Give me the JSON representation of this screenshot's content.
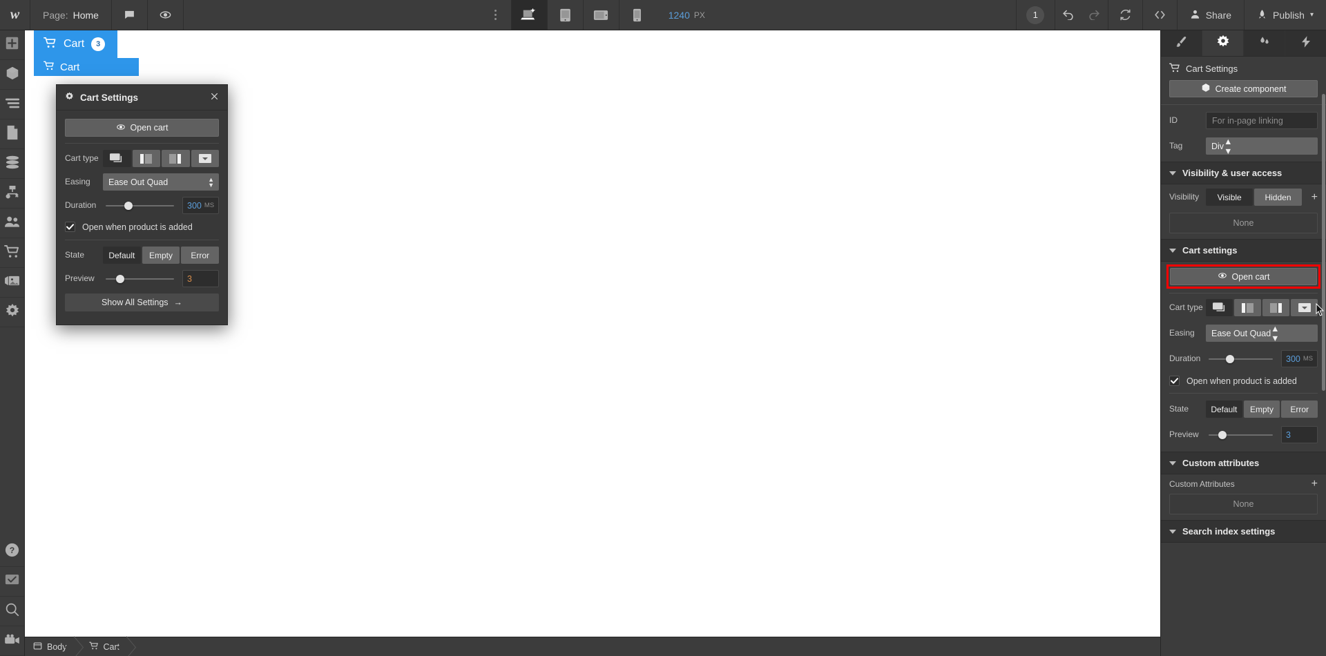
{
  "topbar": {
    "logo": "w",
    "page_label": "Page:",
    "page_value": "Home",
    "comment_icon": "comment-icon",
    "preview_icon": "eye-icon",
    "more_icon": "more-vertical-icon",
    "breakpoints": [
      {
        "name": "desktop-large",
        "icon": "desktop-star-icon",
        "active": true
      },
      {
        "name": "tablet",
        "icon": "tablet-icon",
        "active": false
      },
      {
        "name": "tablet-landscape",
        "icon": "tablet-landscape-icon",
        "active": false
      },
      {
        "name": "mobile",
        "icon": "mobile-icon",
        "active": false
      }
    ],
    "viewport_width": "1240",
    "viewport_unit": "PX",
    "change_count": "1",
    "undo_icon": "undo-icon",
    "redo_icon": "redo-icon",
    "sync_icon": "refresh-icon",
    "code_icon": "code-brackets-icon",
    "share_label": "Share",
    "publish_label": "Publish"
  },
  "rail": {
    "items": [
      {
        "name": "add-elements",
        "icon": "plus-icon"
      },
      {
        "name": "components",
        "icon": "cube-icon"
      },
      {
        "name": "navigator",
        "icon": "layers-list-icon"
      },
      {
        "name": "pages",
        "icon": "page-icon"
      },
      {
        "name": "cms",
        "icon": "database-icon"
      },
      {
        "name": "logic",
        "icon": "flow-icon"
      },
      {
        "name": "users",
        "icon": "users-icon"
      },
      {
        "name": "ecommerce",
        "icon": "cart-icon"
      },
      {
        "name": "assets",
        "icon": "image-stack-icon"
      },
      {
        "name": "settings",
        "icon": "gear-icon"
      }
    ],
    "bottom": [
      {
        "name": "help",
        "icon": "question-circle-icon"
      },
      {
        "name": "audit",
        "icon": "checkbox-icon"
      },
      {
        "name": "search",
        "icon": "magnifier-icon"
      },
      {
        "name": "video",
        "icon": "video-camera-icon"
      }
    ]
  },
  "canvas": {
    "cart_button_label": "Cart",
    "cart_badge": "3",
    "cart_icon": "cart-icon",
    "cart_under_label": "Cart"
  },
  "breadcrumb": {
    "items": [
      {
        "label": "Body",
        "icon": "body-icon"
      },
      {
        "label": "Cart",
        "icon": "cart-icon"
      }
    ]
  },
  "float_panel": {
    "title": "Cart Settings",
    "gear_icon": "gear-icon",
    "close_icon": "close-icon",
    "open_cart_label": "Open cart",
    "open_cart_icon": "eye-icon",
    "cart_type_label": "Cart type",
    "cart_type_options": [
      {
        "name": "modal",
        "icon": "cart-type-modal-icon",
        "selected": true
      },
      {
        "name": "left-sidebar",
        "icon": "cart-type-left-icon",
        "selected": false
      },
      {
        "name": "right-sidebar",
        "icon": "cart-type-right-icon",
        "selected": false
      },
      {
        "name": "dropdown",
        "icon": "cart-type-dropdown-icon",
        "selected": false
      }
    ],
    "easing_label": "Easing",
    "easing_value": "Ease Out Quad",
    "duration_label": "Duration",
    "duration_value": "300",
    "duration_unit": "MS",
    "duration_slider_pct": 30,
    "open_on_add_label": "Open when product is added",
    "open_on_add_checked": true,
    "state_label": "State",
    "state_options": [
      {
        "label": "Default",
        "selected": true
      },
      {
        "label": "Empty",
        "selected": false
      },
      {
        "label": "Error",
        "selected": false
      }
    ],
    "preview_label": "Preview",
    "preview_value": "3",
    "preview_slider_pct": 22,
    "show_all_label": "Show All Settings",
    "show_all_arrow": "→"
  },
  "right_panel": {
    "tabs": [
      {
        "name": "style",
        "icon": "paintbrush-icon",
        "active": false
      },
      {
        "name": "settings",
        "icon": "gear-icon",
        "active": true
      },
      {
        "name": "interactions",
        "icon": "droplets-icon",
        "active": false
      },
      {
        "name": "effects",
        "icon": "lightning-icon",
        "active": false
      }
    ],
    "element_title": "Cart Settings",
    "element_icon": "cart-icon",
    "create_component_label": "Create component",
    "create_component_icon": "cube-icon",
    "id_label": "ID",
    "id_placeholder": "For in-page linking",
    "tag_label": "Tag",
    "tag_value": "Div",
    "visibility_section": "Visibility & user access",
    "visibility_label": "Visibility",
    "visibility_options": [
      {
        "label": "Visible",
        "selected": true
      },
      {
        "label": "Hidden",
        "selected": false
      }
    ],
    "visibility_add_icon": "plus-icon",
    "visibility_none": "None",
    "cart_section": "Cart settings",
    "open_cart_label": "Open cart",
    "open_cart_icon": "eye-icon",
    "open_cart_highlight_color": "#ff0000",
    "cart_type_label": "Cart type",
    "cart_type_options": [
      {
        "name": "modal",
        "icon": "cart-type-modal-icon",
        "selected": true
      },
      {
        "name": "left-sidebar",
        "icon": "cart-type-left-icon",
        "selected": false
      },
      {
        "name": "right-sidebar",
        "icon": "cart-type-right-icon",
        "selected": false
      },
      {
        "name": "dropdown",
        "icon": "cart-type-dropdown-icon",
        "selected": false
      }
    ],
    "easing_label": "Easing",
    "easing_value": "Ease Out Quad",
    "duration_label": "Duration",
    "duration_value": "300",
    "duration_unit": "MS",
    "duration_slider_pct": 30,
    "open_on_add_label": "Open when product is added",
    "open_on_add_checked": true,
    "state_label": "State",
    "state_options": [
      {
        "label": "Default",
        "selected": true
      },
      {
        "label": "Empty",
        "selected": false
      },
      {
        "label": "Error",
        "selected": false
      }
    ],
    "preview_label": "Preview",
    "preview_value": "3",
    "preview_slider_pct": 22,
    "custom_attributes_section": "Custom attributes",
    "custom_attributes_label": "Custom Attributes",
    "custom_attributes_add_icon": "plus-icon",
    "custom_attributes_none": "None",
    "search_index_section": "Search index settings"
  },
  "colors": {
    "accent_blue": "#2e96ea",
    "panel_bg": "#3c3c3c",
    "topbar_bg": "#3c3c3c",
    "highlight_red": "#ff0000",
    "value_orange": "#d58b4a",
    "value_blue": "#5b9dd9"
  }
}
